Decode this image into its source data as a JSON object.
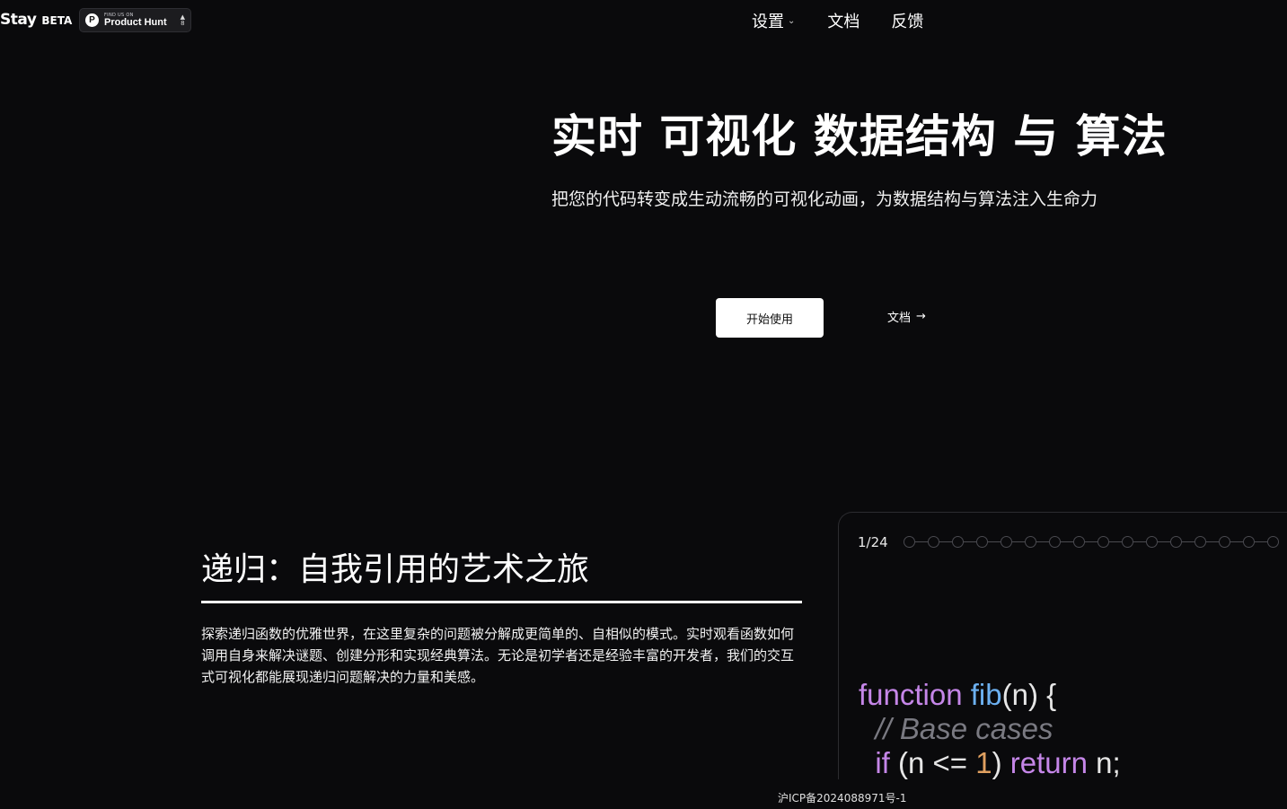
{
  "brand": {
    "name": "Stay",
    "badge": "BETA"
  },
  "product_hunt": {
    "small": "FIND US ON",
    "name": "Product Hunt",
    "logo_letter": "P"
  },
  "nav": {
    "settings": "设置",
    "docs": "文档",
    "feedback": "反馈"
  },
  "hero": {
    "title": "实时 可视化 数据结构 与 算法",
    "subtitle": "把您的代码转变成生动流畅的可视化动画，为数据结构与算法注入生命力",
    "start_button": "开始使用",
    "docs_button": "文档"
  },
  "feature": {
    "title": "递归：自我引用的艺术之旅",
    "description": "探索递归函数的优雅世界，在这里复杂的问题被分解成更简单的、自相似的模式。实时观看函数如何调用自身来解决谜题、创建分形和实现经典算法。无论是初学者还是经验丰富的开发者，我们的交互式可视化都能展现递归问题解决的力量和美感。"
  },
  "code_panel": {
    "step_counter": "1/24",
    "steps_total": 24,
    "steps_visible": 16,
    "current_step": 1,
    "code_lines": [
      {
        "kw": "function",
        "fn": "fib",
        "rest": "(n) {"
      },
      {
        "comment": "// Base cases"
      },
      {
        "kw": "if",
        "pre": " (n <= ",
        "num": "1",
        "post": ") ",
        "kw2": "return",
        "tail": " n;"
      }
    ]
  },
  "footer": {
    "icp": "沪ICP备2024088971号-1"
  }
}
